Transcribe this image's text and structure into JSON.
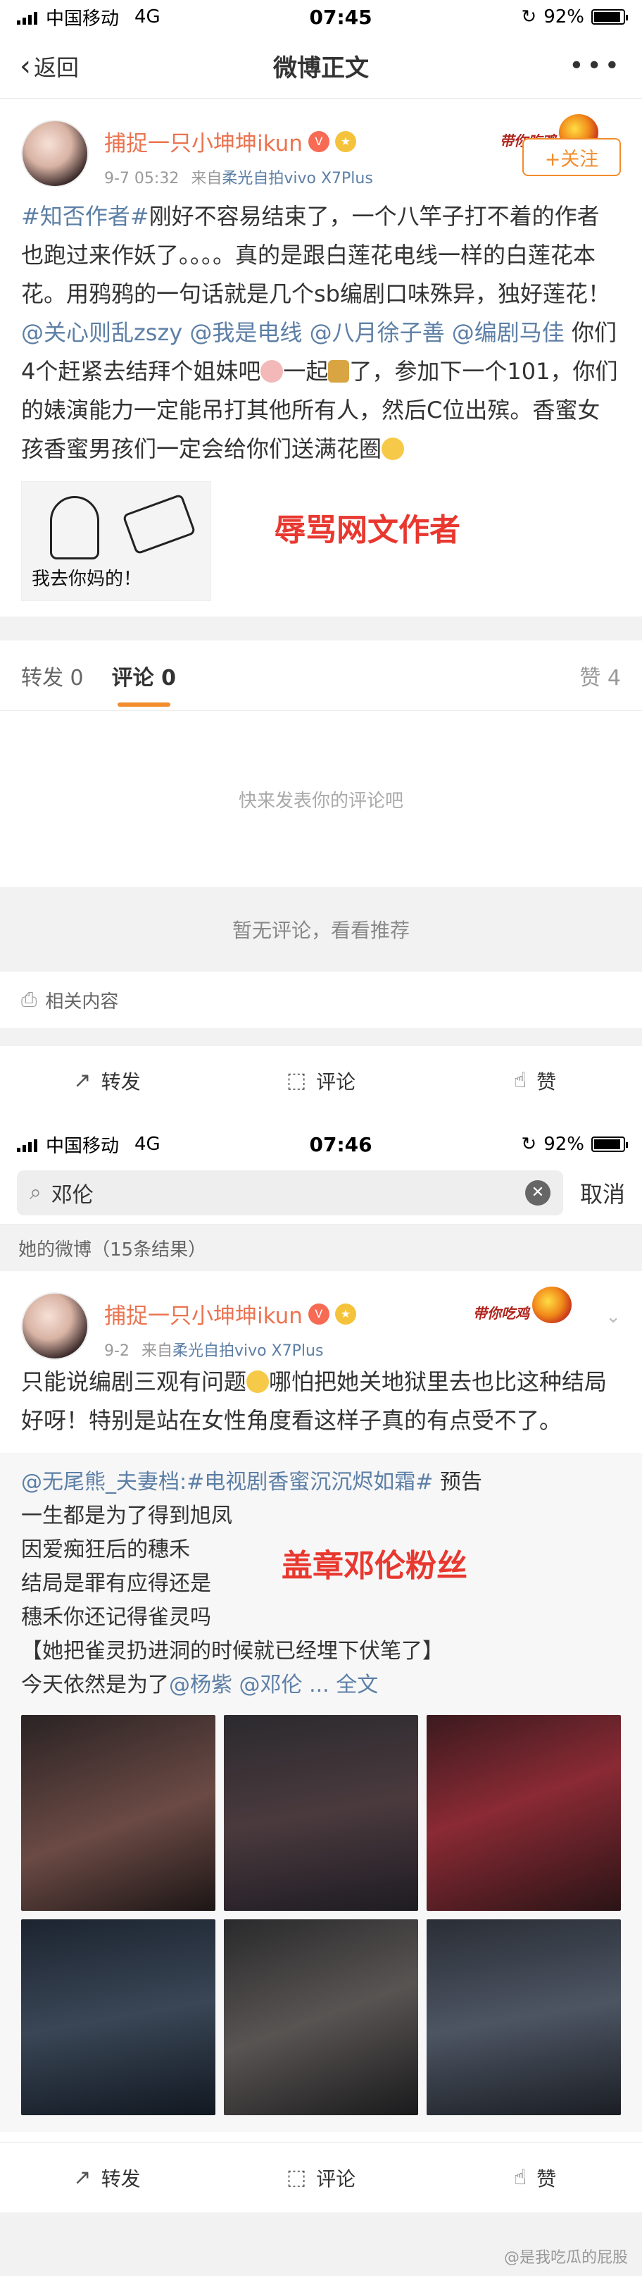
{
  "screen1": {
    "status": {
      "carrier": "中国移动",
      "network": "4G",
      "time": "07:45",
      "battery": "92%"
    },
    "nav": {
      "back_label": "返回",
      "title": "微博正文",
      "more": "•••"
    },
    "post": {
      "username": "捕捉一只小坤坤ikun",
      "timestamp": "9-7 05:32",
      "source_prefix": "来自",
      "source": "柔光自拍vivo X7Plus",
      "follow_label": "+关注",
      "deco_text": "带你吃鸡",
      "text_parts": [
        {
          "t": "#知否作者#",
          "tag": true
        },
        {
          "t": "刚好不容易结束了，一个八竿子打不着的作者也跑过来作妖了。。。。真的是跟白莲花电线一样的白莲花本花。用鸦鸦的一句话就是几个sb编剧口味殊异，独好莲花！",
          "tag": false
        },
        {
          "t": "@关心则乱zszy",
          "tag": true
        },
        {
          "t": " ",
          "tag": false
        },
        {
          "t": "@我是电线",
          "tag": true
        },
        {
          "t": " ",
          "tag": false
        },
        {
          "t": "@八月徐子善",
          "tag": true
        },
        {
          "t": " ",
          "tag": false
        },
        {
          "t": "@编剧马佳",
          "tag": true
        },
        {
          "t": " 你们4个赶紧去结拜个姐妹吧",
          "tag": false
        }
      ],
      "text_tail1": "一起",
      "text_tail2": "了，参加下一个101，你们的婊演能力一定能吊打其他所有人，然后C位出殡。香蜜女孩香蜜男孩们一定会给你们送满花圈",
      "meme_caption": "我去你妈的！",
      "annotation": "辱骂网文作者"
    },
    "tabs": {
      "repost": "转发 0",
      "comment": "评论 0",
      "like": "赞 4"
    },
    "empty_prompt": "快来发表你的评论吧",
    "no_comment": "暂无评论，看看推荐",
    "related": "相关内容",
    "toolbar": {
      "repost": "转发",
      "comment": "评论",
      "like": "赞"
    }
  },
  "screen2": {
    "status": {
      "carrier": "中国移动",
      "network": "4G",
      "time": "07:46",
      "battery": "92%"
    },
    "search": {
      "query": "邓伦",
      "cancel": "取消"
    },
    "results_header": "她的微博（15条结果）",
    "post": {
      "username": "捕捉一只小坤坤ikun",
      "timestamp": "9-2",
      "source_prefix": "来自",
      "source": "柔光自拍vivo X7Plus",
      "deco_text": "带你吃鸡",
      "text1": "只能说编剧三观有问题",
      "text2": "哪怕把她关地狱里去也比这种结局好呀！特别是站在女性角度看这样子真的有点受不了。",
      "quote_author": "@无尾熊_夫妻档",
      "quote_topic": ":#电视剧香蜜沉沉烬如霜#",
      "quote_after": " 预告",
      "quote_lines": [
        "一生都是为了得到旭凤",
        "因爱痴狂后的穗禾",
        "结局是罪有应得还是",
        "穗禾你还记得雀灵吗",
        "【她把雀灵扔进洞的时候就已经埋下伏笔了】"
      ],
      "quote_last_prefix": "今天依然是为了",
      "quote_mention1": "@杨紫",
      "quote_mention2": "@邓伦",
      "quote_more": "... 全文",
      "annotation": "盖章邓伦粉丝",
      "watermark": "@是我吃瓜的屁股"
    },
    "toolbar": {
      "repost": "转发",
      "comment": "评论",
      "like": "赞"
    }
  },
  "colors": {
    "accent": "#f28c2c",
    "link": "#5d7fa6",
    "username": "#eb7350",
    "annotation": "#e8382f"
  }
}
